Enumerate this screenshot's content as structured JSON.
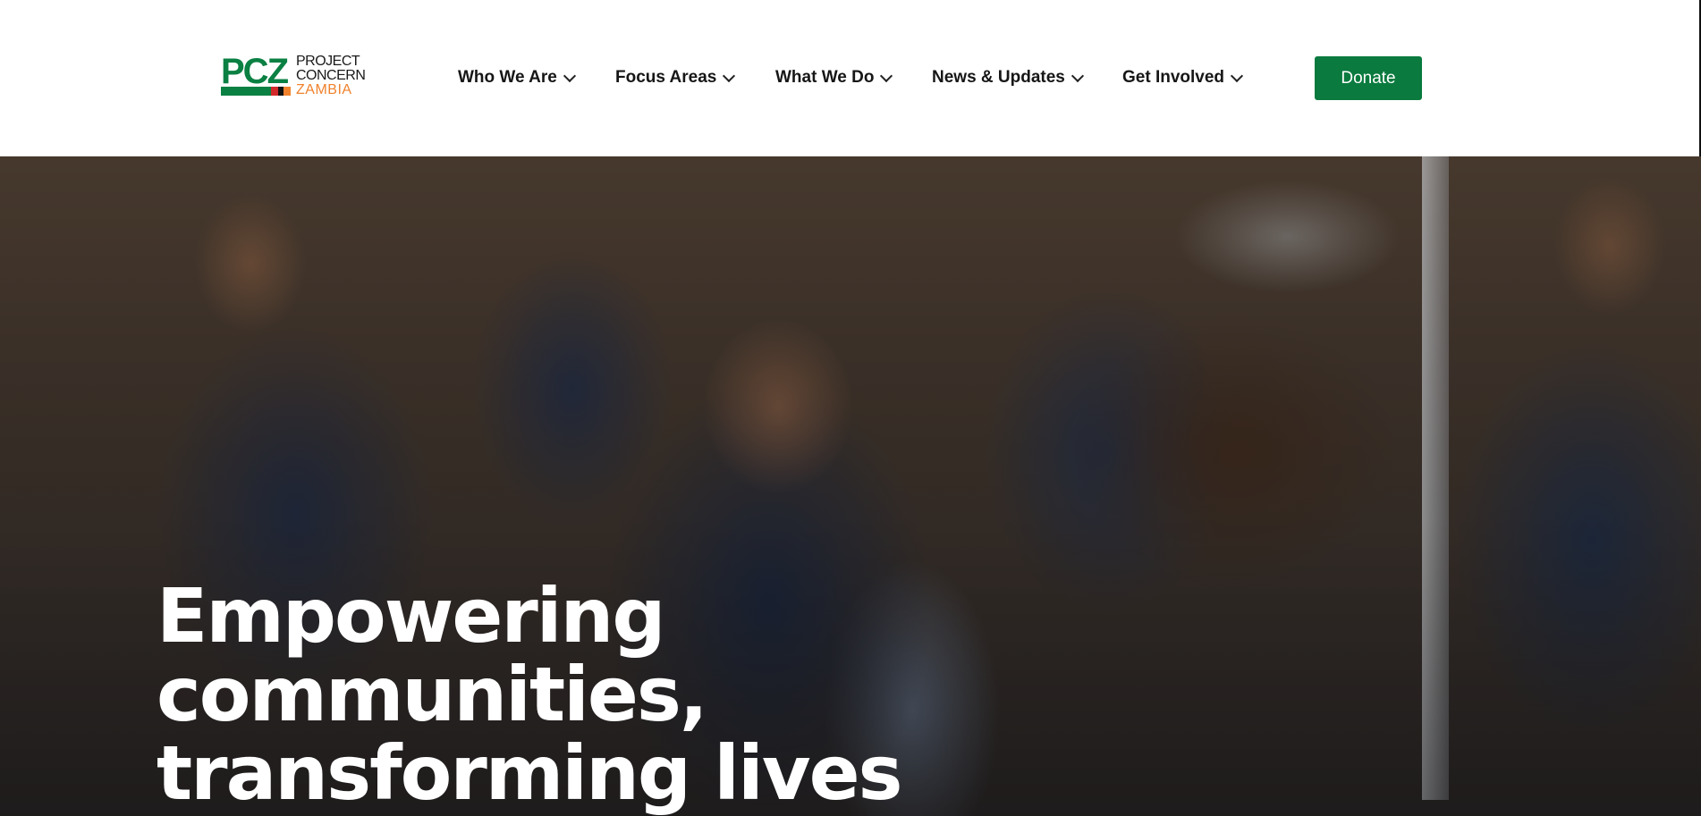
{
  "header": {
    "logo": {
      "mark": "PCZ",
      "line1": "PROJECT",
      "line2": "CONCERN",
      "line3": "ZAMBIA",
      "stripe_colors": [
        "#0a8043",
        "#d22a2a",
        "#111111",
        "#f0822d"
      ]
    },
    "nav": [
      {
        "label": "Who We Are"
      },
      {
        "label": "Focus Areas"
      },
      {
        "label": "What We Do"
      },
      {
        "label": "News & Updates"
      },
      {
        "label": "Get Involved"
      }
    ],
    "donate_label": "Donate"
  },
  "hero": {
    "heading_lines": [
      "Empowering",
      "communities,",
      "transforming lives"
    ]
  },
  "colors": {
    "brand_green": "#0a7a3e",
    "brand_orange": "#f0822d",
    "nav_text": "#161616"
  }
}
